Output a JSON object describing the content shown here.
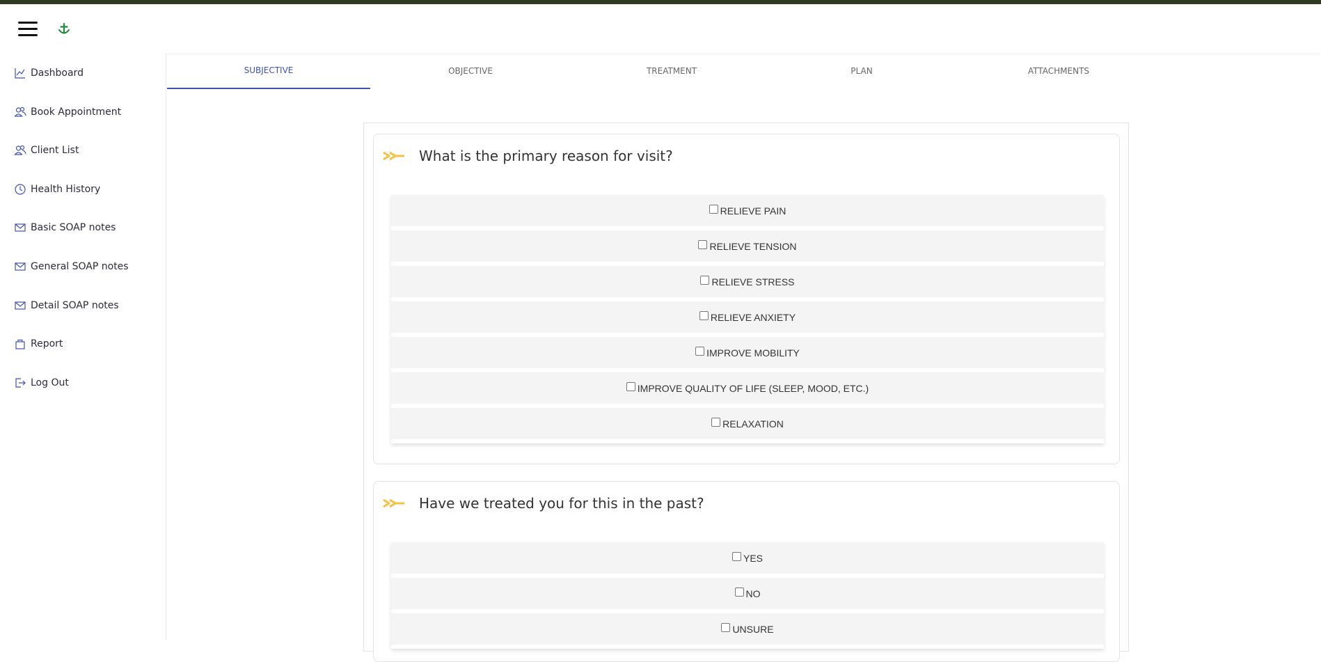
{
  "header": {
    "menu_icon": "hamburger-icon",
    "logo_icon": "anchor-plus-icon"
  },
  "sidebar": {
    "items": [
      {
        "label": "Dashboard",
        "icon": "line-chart-icon"
      },
      {
        "label": "Book Appointment",
        "icon": "users-icon"
      },
      {
        "label": "Client List",
        "icon": "users-icon"
      },
      {
        "label": "Health History",
        "icon": "clock-icon"
      },
      {
        "label": "Basic SOAP notes",
        "icon": "mail-icon"
      },
      {
        "label": "General SOAP notes",
        "icon": "mail-icon"
      },
      {
        "label": "Detail SOAP notes",
        "icon": "mail-icon"
      },
      {
        "label": "Report",
        "icon": "bag-icon"
      },
      {
        "label": "Log Out",
        "icon": "logout-icon"
      }
    ]
  },
  "tabs": [
    {
      "label": "SUBJECTIVE",
      "active": true
    },
    {
      "label": "OBJECTIVE",
      "active": false
    },
    {
      "label": "TREATMENT",
      "active": false
    },
    {
      "label": "PLAN",
      "active": false
    },
    {
      "label": "ATTACHMENTS",
      "active": false
    }
  ],
  "questions": [
    {
      "title": "What is the primary reason for visit?",
      "options": [
        "RELIEVE PAIN",
        "RELIEVE TENSION",
        "RELIEVE STRESS",
        "RELIEVE ANXIETY",
        "IMPROVE MOBILITY",
        "IMPROVE QUALITY OF LIFE (SLEEP, MOOD, ETC.)",
        "RELAXATION"
      ]
    },
    {
      "title": "Have we treated you for this in the past?",
      "options": [
        "YES",
        "NO",
        "UNSURE"
      ]
    }
  ],
  "colors": {
    "accent": "#3f51b5",
    "arrow": "#f5c242",
    "top_strip": "#2e3b22",
    "logo": "#1f8a3a"
  }
}
